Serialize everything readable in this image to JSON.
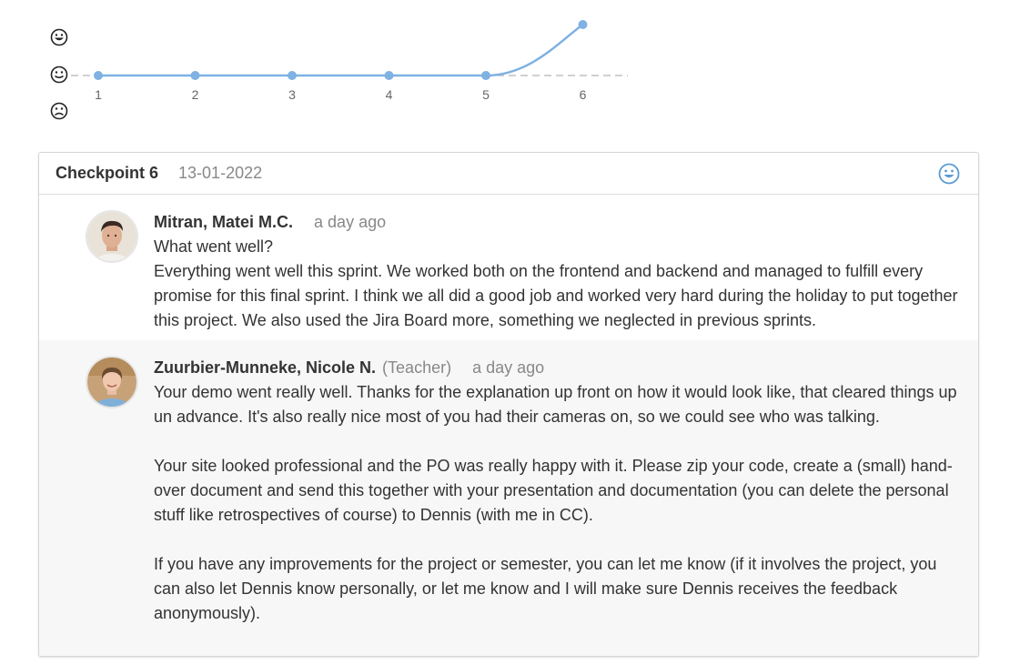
{
  "mood_chart": {
    "x_labels": [
      "1",
      "2",
      "3",
      "4",
      "5",
      "6"
    ],
    "mood_levels": [
      "happy",
      "neutral",
      "sad"
    ],
    "values": [
      "neutral",
      "neutral",
      "neutral",
      "neutral",
      "neutral",
      "happy"
    ],
    "line_color": "#7fb1e3",
    "baseline_color": "#b5b5b5"
  },
  "checkpoint": {
    "title": "Checkpoint 6",
    "date": "13-01-2022",
    "mood_icon": "smiley-icon",
    "comments": [
      {
        "author": "Mitran, Matei M.C.",
        "role": "",
        "time": "a day ago",
        "body": "What went well?\nEverything went well this sprint. We worked both on the frontend and backend and managed to fulfill every promise for this final sprint. I think we all did a good job and worked very hard during the holiday to put together this project. We also used the Jira Board more, something we neglected in previous sprints."
      },
      {
        "author": "Zuurbier-Munneke, Nicole N.",
        "role": "(Teacher)",
        "time": "a day ago",
        "body": "Your demo went really well. Thanks for the explanation up front on how it would look like, that cleared things up un advance. It's also really nice most of you had their cameras on, so we could see who was talking.\n\nYour site looked professional and the PO was really happy with it. Please zip your code,  create a (small) hand-over document and send this together with your presentation and documentation (you can delete the personal stuff like retrospectives of course) to Dennis (with me in CC).\n\nIf you have any improvements for the project or semester, you can let me know (if it involves the project, you can also let Dennis know personally, or let me know and I will make sure Dennis receives the feedback anonymously)."
      }
    ]
  }
}
